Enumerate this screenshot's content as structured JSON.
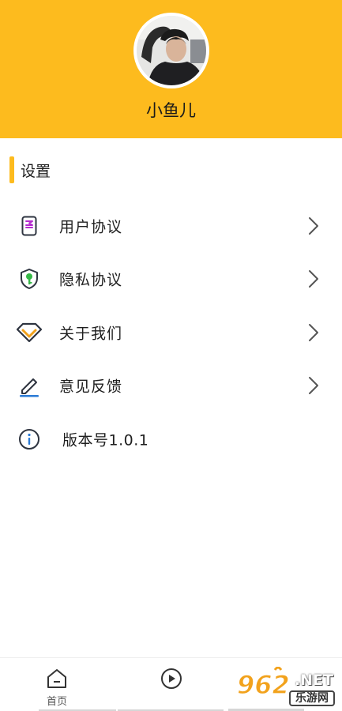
{
  "profile": {
    "username": "小鱼儿"
  },
  "settings": {
    "title": "设置",
    "items": [
      {
        "label": "用户协议",
        "icon": "document-icon",
        "has_chevron": true
      },
      {
        "label": "隐私协议",
        "icon": "shield-key-icon",
        "has_chevron": true
      },
      {
        "label": "关于我们",
        "icon": "diamond-icon",
        "has_chevron": true
      },
      {
        "label": "意见反馈",
        "icon": "pencil-icon",
        "has_chevron": true
      },
      {
        "label": "版本号1.0.1",
        "icon": "info-icon",
        "has_chevron": false
      }
    ]
  },
  "tabbar": {
    "tabs": [
      {
        "label": "首页",
        "icon": "home-icon"
      },
      {
        "label": "",
        "icon": "play-icon"
      }
    ]
  },
  "watermark": {
    "logo_text": "962",
    "domain": ".NET",
    "site": "乐游网"
  },
  "colors": {
    "header": "#FDBB1E",
    "accent_bar": "#FDBB1E",
    "icon_purple": "#B52BCF",
    "icon_green": "#35B847",
    "icon_orange": "#F2A21C",
    "icon_blue": "#2B7BD6",
    "icon_dark": "#2E3440"
  }
}
